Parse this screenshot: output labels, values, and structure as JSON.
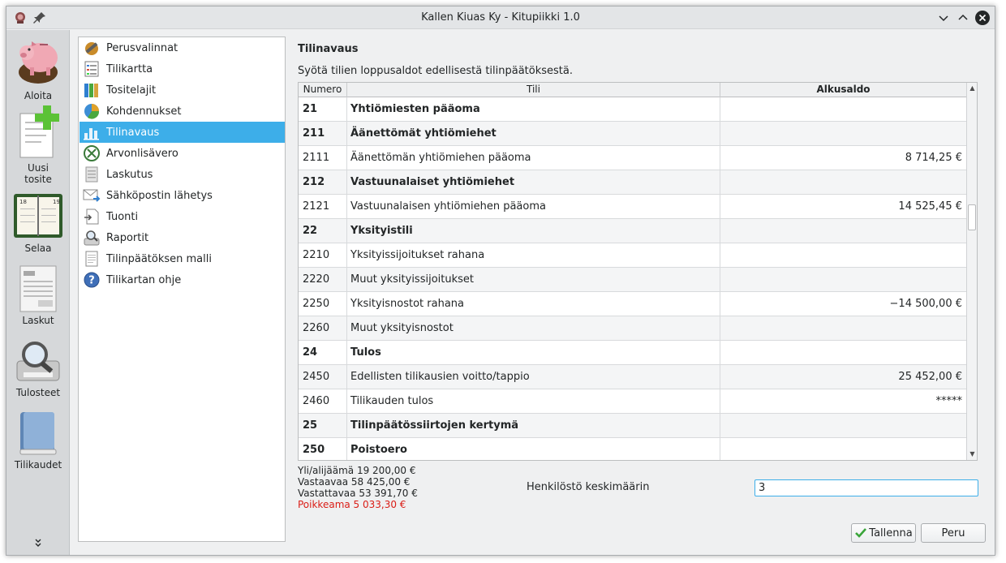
{
  "window": {
    "title": "Kallen Kiuas Ky - Kitupiikki 1.0"
  },
  "leftbar": {
    "items": [
      {
        "label": "Aloita",
        "icon": "piggy-bank-icon"
      },
      {
        "label": "Uusi",
        "label2": "tosite",
        "icon": "new-voucher-icon"
      },
      {
        "label": "Selaa",
        "icon": "calendar-book-icon"
      },
      {
        "label": "Laskut",
        "icon": "invoice-icon"
      },
      {
        "label": "Tulosteet",
        "icon": "printer-magnifier-icon"
      },
      {
        "label": "Tilikaudet",
        "icon": "book-icon"
      }
    ],
    "more": "»"
  },
  "nav": {
    "items": [
      {
        "label": "Perusvalinnat",
        "icon": "wrench-screwdriver-icon"
      },
      {
        "label": "Tilikartta",
        "icon": "list-icon"
      },
      {
        "label": "Tositelajit",
        "icon": "binders-icon"
      },
      {
        "label": "Kohdennukset",
        "icon": "pie-chart-icon"
      },
      {
        "label": "Tilinavaus",
        "icon": "bar-chart-icon"
      },
      {
        "label": "Arvonlisävero",
        "icon": "vat-icon"
      },
      {
        "label": "Laskutus",
        "icon": "document-icon"
      },
      {
        "label": "Sähköpostin lähetys",
        "icon": "mail-icon"
      },
      {
        "label": "Tuonti",
        "icon": "import-icon"
      },
      {
        "label": "Raportit",
        "icon": "report-search-icon"
      },
      {
        "label": "Tilinpäätöksen malli",
        "icon": "page-icon"
      },
      {
        "label": "Tilikartan ohje",
        "icon": "help-icon"
      }
    ],
    "active_index": 4
  },
  "main": {
    "title": "Tilinavaus",
    "description": "Syötä tilien loppusaldot edellisestä tilinpäätöksestä."
  },
  "table": {
    "headers": [
      "Numero",
      "Tili",
      "Alkusaldo"
    ],
    "rows": [
      {
        "numero": "21",
        "tili": "Yhtiömiesten pääoma",
        "saldo": "",
        "bold": true
      },
      {
        "numero": "211",
        "tili": "Äänettömät yhtiömiehet",
        "saldo": "",
        "bold": true
      },
      {
        "numero": "2111",
        "tili": "Äänettömän yhtiömiehen pääoma",
        "saldo": "8 714,25 €",
        "bold": false
      },
      {
        "numero": "212",
        "tili": "Vastuunalaiset yhtiömiehet",
        "saldo": "",
        "bold": true
      },
      {
        "numero": "2121",
        "tili": "Vastuunalaisen yhtiömiehen pääoma",
        "saldo": "14 525,45 €",
        "bold": false
      },
      {
        "numero": "22",
        "tili": "Yksityistili",
        "saldo": "",
        "bold": true
      },
      {
        "numero": "2210",
        "tili": "Yksityissijoitukset rahana",
        "saldo": "",
        "bold": false
      },
      {
        "numero": "2220",
        "tili": "Muut yksityissijoitukset",
        "saldo": "",
        "bold": false
      },
      {
        "numero": "2250",
        "tili": "Yksityisnostot rahana",
        "saldo": "−14 500,00 €",
        "bold": false
      },
      {
        "numero": "2260",
        "tili": "Muut yksityisnostot",
        "saldo": "",
        "bold": false
      },
      {
        "numero": "24",
        "tili": "Tulos",
        "saldo": "",
        "bold": true
      },
      {
        "numero": "2450",
        "tili": "Edellisten tilikausien voitto/tappio",
        "saldo": "25 452,00 €",
        "bold": false
      },
      {
        "numero": "2460",
        "tili": "Tilikauden tulos",
        "saldo": "*****",
        "bold": false
      },
      {
        "numero": "25",
        "tili": "Tilinpäätössiirtojen kertymä",
        "saldo": "",
        "bold": true
      },
      {
        "numero": "250",
        "tili": "Poistoero",
        "saldo": "",
        "bold": true
      }
    ]
  },
  "summary": {
    "yli": "Yli/alijäämä 19 200,00 €",
    "vastaavaa": "Vastaavaa 58 425,00 €",
    "vastattavaa": "Vastattavaa 53 391,70 €",
    "poikkeama": "Poikkeama 5 033,30 €",
    "poikkeama_color": "#da1d16"
  },
  "henkilosto": {
    "label": "Henkilöstö keskimäärin",
    "value": "3"
  },
  "buttons": {
    "save": "Tallenna",
    "cancel": "Peru"
  },
  "colors": {
    "accent": "#3daee9"
  }
}
